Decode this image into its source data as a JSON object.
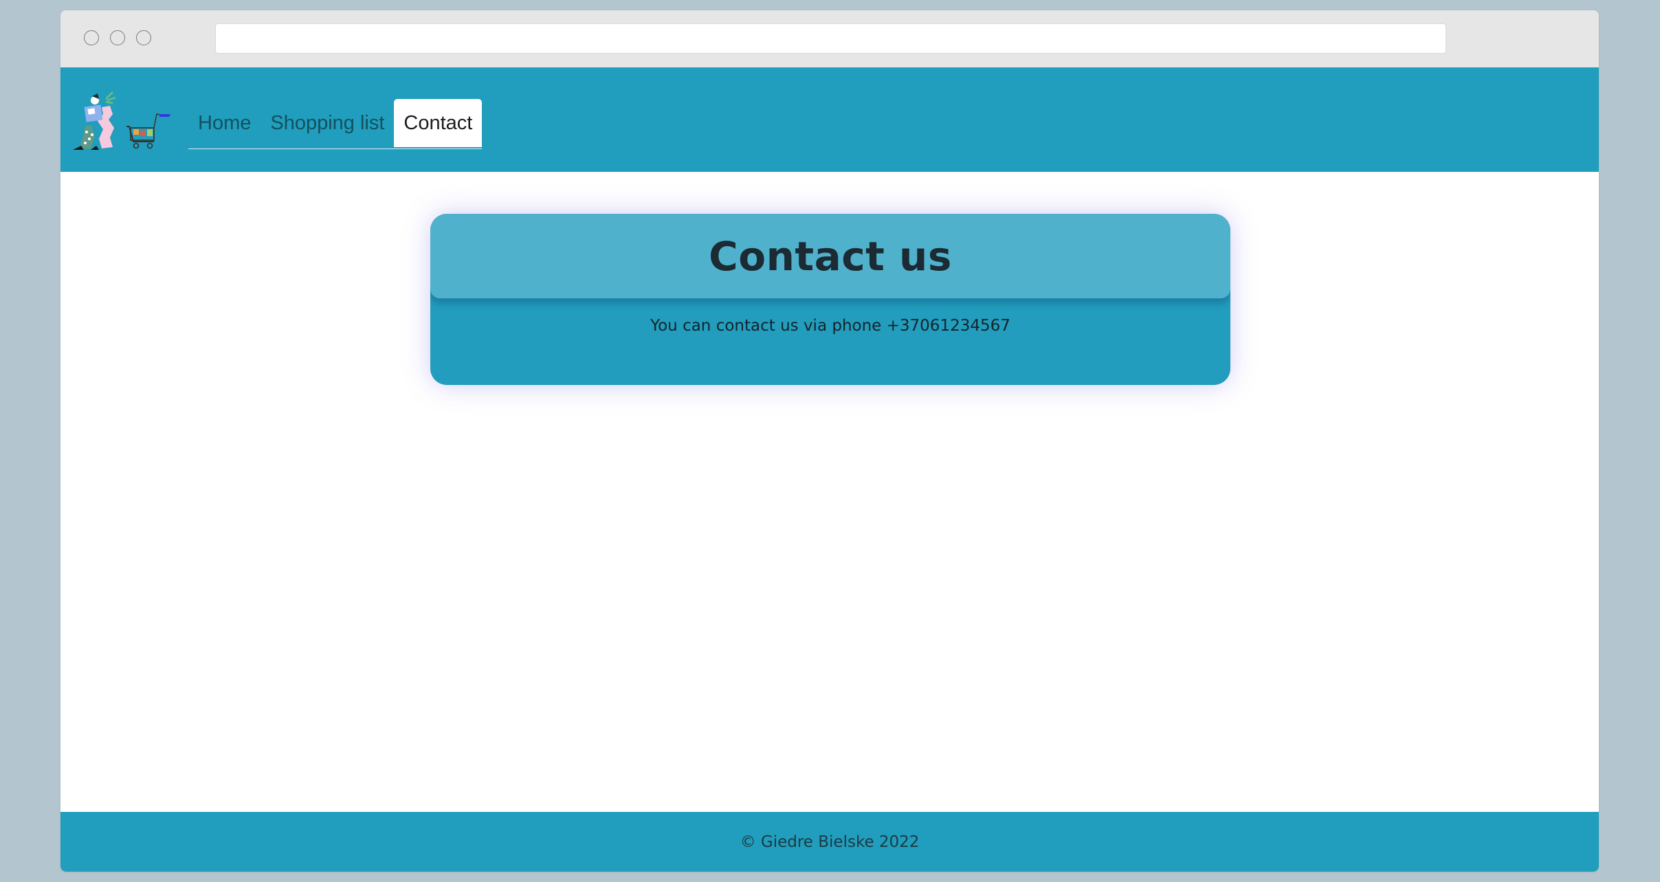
{
  "nav": {
    "items": [
      {
        "label": "Home"
      },
      {
        "label": "Shopping list"
      },
      {
        "label": "Contact"
      }
    ],
    "active": "Contact"
  },
  "card": {
    "title": "Contact us",
    "body": "You can contact us via phone +37061234567"
  },
  "footer": {
    "text": "© Giedre Bielske 2022"
  },
  "colors": {
    "background": "#b3c5ce",
    "navbar": "#219ebd",
    "card_header": "#4fb1cb",
    "card_body": "#229dbd",
    "footer": "#219ebd"
  },
  "icons": {
    "logo": "shopping-people-cart-illustration"
  }
}
